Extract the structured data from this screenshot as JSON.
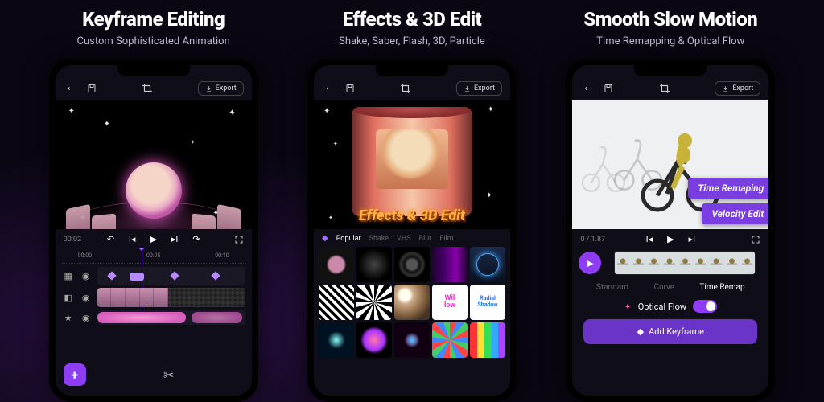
{
  "export_label": "Export",
  "panel1": {
    "title": "Keyframe Editing",
    "subtitle": "Custom Sophisticated Animation",
    "time_display": "00:02",
    "ruler": [
      "00:00",
      "00:05",
      "00:10"
    ],
    "fab_glyph": "+"
  },
  "panel2": {
    "title": "Effects & 3D Edit",
    "subtitle": "Shake, Saber, Flash, 3D, Particle",
    "overlay_text": "Effects & 3D Edit",
    "tabs": [
      "Popular",
      "Shake",
      "VHS",
      "Blur",
      "Film"
    ],
    "radial_label": "Radial Shadow"
  },
  "panel3": {
    "title": "Smooth Slow Motion",
    "subtitle": "Time Remapping & Optical Flow",
    "tag1": "Time Remaping",
    "tag2": "Velocity Edit",
    "time_display": "0 / 1.87",
    "mode_tabs": [
      "Standard",
      "Curve",
      "Time Remap"
    ],
    "optical_flow_label": "Optical Flow",
    "add_keyframe_label": "Add Keyframe"
  }
}
